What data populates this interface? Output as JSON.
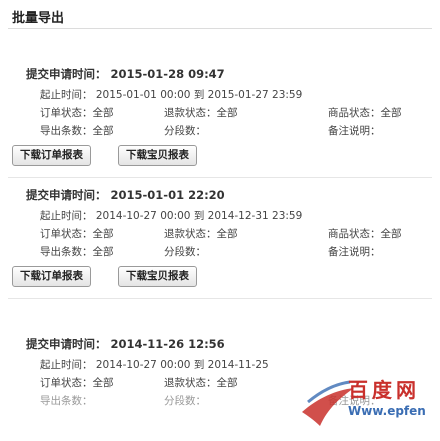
{
  "page": {
    "title": "批量导出"
  },
  "labels": {
    "submit_time": "提交申请时间",
    "time_range": "起止时间",
    "orders": "订单状态",
    "refund": "退款状态",
    "export_count": "导出条数",
    "parts": "分段数",
    "goods": "商品状态",
    "remark": "备注说明",
    "all": "全部",
    "to": "到"
  },
  "buttons": {
    "download_orders": "下载订单报表",
    "download_goods": "下载宝贝报表"
  },
  "records": [
    {
      "submit_time": "2015-01-28 09:47",
      "start": "2015-01-01 00:00",
      "end": "2015-01-27 23:59",
      "order_status": "全部",
      "refund_status": "全部",
      "goods_status": "全部",
      "pay_status": "全部"
    },
    {
      "submit_time": "2015-01-01 22:20",
      "start": "2014-10-27 00:00",
      "end": "2014-12-31 23:59",
      "order_status": "全部",
      "refund_status": "全部",
      "goods_status": "全部",
      "pay_status": "全部"
    },
    {
      "submit_time": "2014-11-26 12:56",
      "start": "2014-10-27 00:00",
      "end": "2014-11-25",
      "order_status": "全部",
      "refund_status": "全部"
    }
  ],
  "watermark": {
    "line1": "百度网",
    "line2": "Www.epfen"
  },
  "colors": {
    "watermark_red": "#c9302c",
    "watermark_blue": "#3a6db3"
  }
}
